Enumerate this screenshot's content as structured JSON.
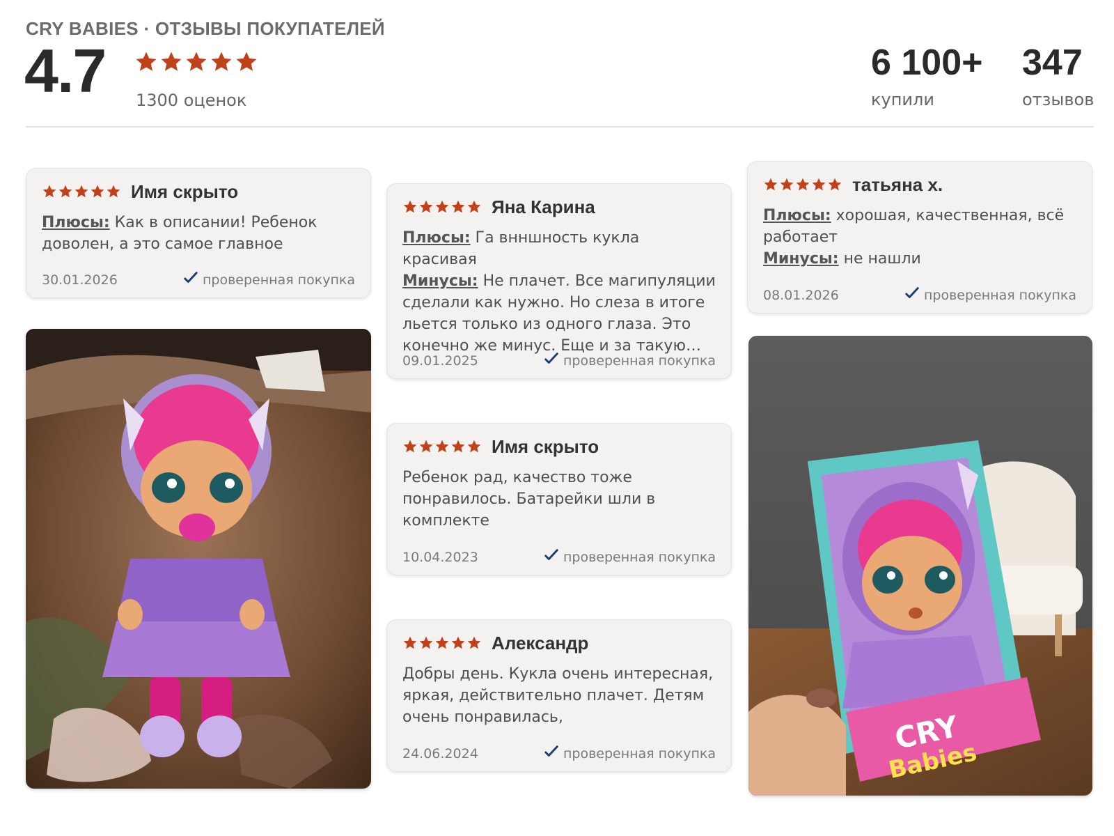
{
  "header": {
    "title": "CRY BABIES · ОТЗЫВЫ ПОКУПАТЕЛЕЙ",
    "rating": "4.7",
    "rating_count": "1300 оценок",
    "bought_value": "6 100+",
    "bought_label": "купили",
    "reviews_value": "347",
    "reviews_label": "отзывов"
  },
  "colors": {
    "star": "#c0421b",
    "check": "#1f3b73",
    "card_bg": "#f3f2f1"
  },
  "icons": {
    "star": "star-icon",
    "verified": "checkmark-icon"
  },
  "reviews": [
    {
      "rating": 5,
      "author": "Имя скрыто",
      "pros_label": "Плюсы:",
      "pros": " Как в описании! Ребенок\nдоволен, а это самое главное",
      "date": "30.01.2026",
      "verified": "проверенная покупка"
    },
    {
      "rating": 5,
      "author": "Яна Карина",
      "pros_label": "Плюсы:",
      "pros": " Га внншность кукла красивая",
      "cons_label": "Минусы:",
      "cons": " Не плачет. Все магипуляции\nсделали как нужно. Но слеза в итоге\nльется только из одного глаза. Это\nконечно же минус. Еще и за такую…",
      "date": "09.01.2025",
      "verified": "проверенная покупка"
    },
    {
      "rating": 5,
      "author": "Имя скрыто",
      "text": "Ребенок рад, качество тоже\nпонравилось. Батарейки шли в\nкомплекте",
      "date": "10.04.2023",
      "verified": "проверенная покупка"
    },
    {
      "rating": 5,
      "author": "Александр",
      "text": "Добры день. Кукла очень интересная,\nяркая, действительно плачет. Детям\nочень понравилась,",
      "date": "24.06.2024",
      "verified": "проверенная покупка"
    },
    {
      "rating": 5,
      "author": "татьяна х.",
      "pros_label": "Плюсы:",
      "pros": " хорошая, качественная, всё\nработает",
      "cons_label": "Минусы:",
      "cons": " не нашли",
      "date": "08.01.2026",
      "verified": "проверенная покупка"
    }
  ],
  "photos": [
    {
      "icon": "doll-photo"
    },
    {
      "icon": "doll-box-photo"
    }
  ]
}
